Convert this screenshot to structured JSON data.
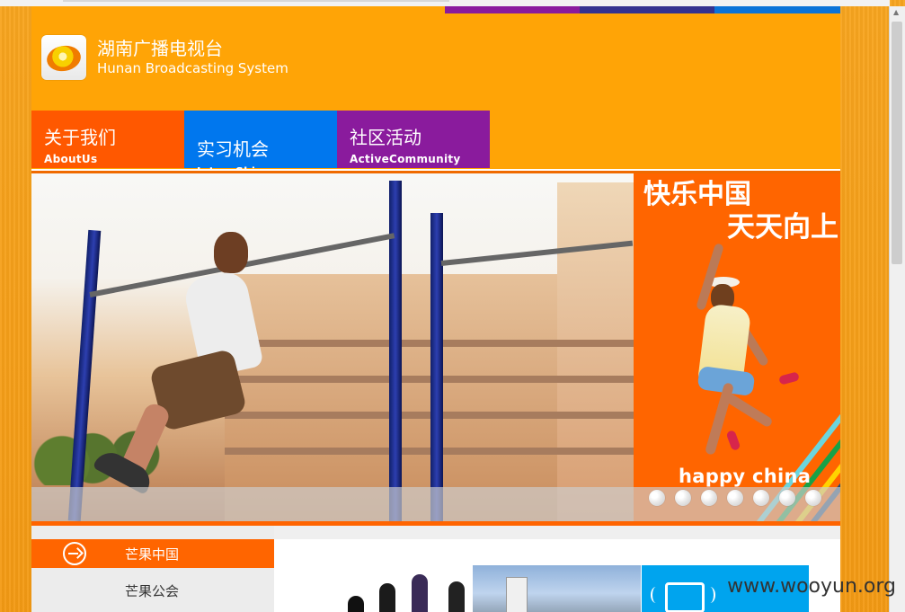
{
  "site": {
    "title_cn": "湖南广播电视台",
    "title_en": "Hunan Broadcasting System",
    "logo_icon": "mango-logo-icon"
  },
  "colors": {
    "page": "#f7a21b",
    "container": "#ffa406",
    "nav_orange": "#ff5800",
    "nav_blue": "#0077ee",
    "nav_purple": "#8a1b9d",
    "banner_orange": "#ff6500",
    "bar_purple": "#8a1b9d",
    "bar_indigo": "#34328f",
    "bar_blue": "#0a73d8"
  },
  "nav": [
    {
      "label_cn": "关于我们",
      "label_en": "AboutUs"
    },
    {
      "label_cn": "实习机会",
      "label_en": "InternShip"
    },
    {
      "label_cn": "社区活动",
      "label_en": "ActiveCommunity"
    }
  ],
  "banner": {
    "promo_line1": "快乐中国",
    "promo_line2": "天天向上",
    "promo_footer": "happy china",
    "carousel_total": 7
  },
  "sidebar": {
    "items": [
      {
        "label": "芒果中国"
      },
      {
        "label": "芒果公会"
      }
    ]
  },
  "watermark": "www.wooyun.org"
}
